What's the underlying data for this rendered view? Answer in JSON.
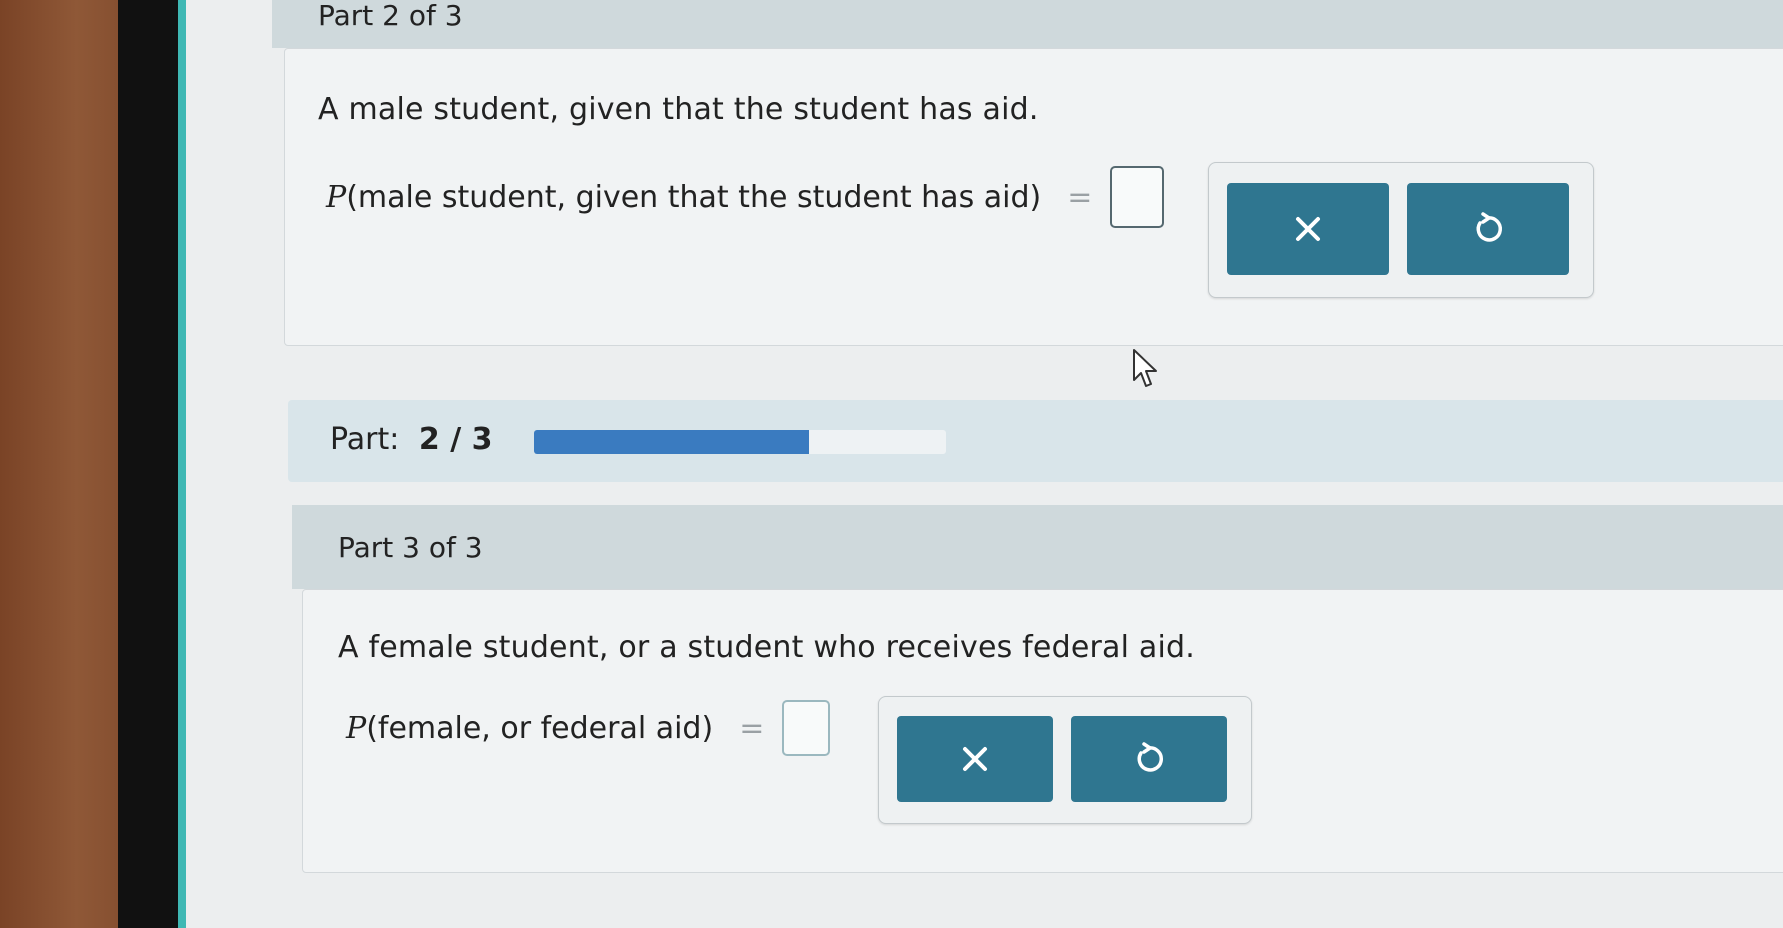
{
  "part2": {
    "header": "Part 2 of 3",
    "question": "A male student, given that the student has aid.",
    "formula_p": "P",
    "formula_args": "(male student, given that the student has aid)",
    "equals": "="
  },
  "progress": {
    "label": "Part:",
    "current_of_total": "2 / 3",
    "fraction": 0.6667
  },
  "part3": {
    "header": "Part 3 of 3",
    "question": "A female student, or a student who receives federal aid.",
    "formula_p": "P",
    "formula_args": "(female, or federal aid)",
    "equals": "="
  },
  "icons": {
    "clear": "close-icon",
    "reset": "undo-icon"
  },
  "colors": {
    "button": "#2f7690",
    "progress": "#3a7bc0",
    "header_bg": "#cfd9dc"
  }
}
